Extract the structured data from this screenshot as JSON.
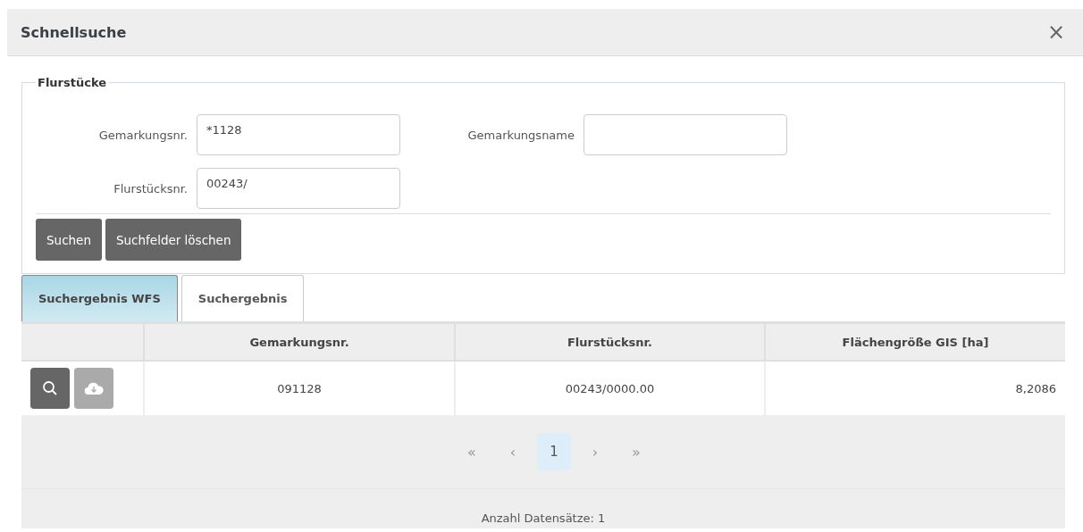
{
  "dialog": {
    "title": "Schnellsuche",
    "close": "×"
  },
  "fieldset": {
    "legend": "Flurstücke",
    "fields": [
      {
        "label": "Gemarkungsnr.",
        "value": "*1128"
      },
      {
        "label": "Gemarkungsname"
      },
      {
        "label": "Flurstücksnr.",
        "value": "00243/"
      }
    ],
    "buttons": [
      "Suchen",
      "Suchfelder löschen"
    ]
  },
  "tabs": [
    {
      "label": "Suchergebnis WFS",
      "selected": true
    },
    {
      "label": "Suchergebnis",
      "selected": false
    }
  ],
  "table": {
    "columns": [
      "Gemarkungsnr.",
      "Flurstücksnr.",
      "Flächengröße GIS [ha]"
    ],
    "rows": [
      {
        "actions": [
          {
            "kind": "search",
            "disabled": false
          },
          {
            "kind": "download",
            "disabled": true
          }
        ],
        "cells": [
          "091128",
          "00243/0000.00",
          "8,2086"
        ]
      }
    ]
  },
  "pager": [
    {
      "label": "«",
      "selected": false
    },
    {
      "label": "‹",
      "selected": false
    },
    {
      "label": "1",
      "selected": true
    },
    {
      "label": "›",
      "selected": false
    },
    {
      "label": "»",
      "selected": false
    }
  ],
  "footer": "Anzahl Datensätze: 1"
}
